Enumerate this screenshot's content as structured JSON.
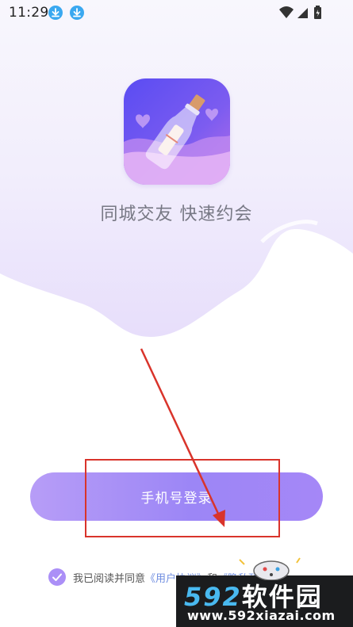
{
  "status_bar": {
    "time": "11:29",
    "left_icons": [
      "download-icon",
      "download-icon"
    ],
    "right_icons": [
      "wifi-icon",
      "signal-icon",
      "battery-icon"
    ]
  },
  "app": {
    "icon": "message-bottle-icon",
    "slogan": "同城交友 快速约会"
  },
  "login": {
    "button_label": "手机号登录"
  },
  "agreement": {
    "checked": true,
    "prefix": "我已阅读并同意",
    "link1": "《用户协议》",
    "conjunction": "和",
    "link2": "《隐私政策》"
  },
  "watermark": {
    "brand_number": "592",
    "brand_text": "软件园",
    "url": "www.592xiazai.com"
  },
  "colors": {
    "accent": "#a98cf7",
    "annotation": "#d9342b",
    "text_gray": "#777884"
  }
}
